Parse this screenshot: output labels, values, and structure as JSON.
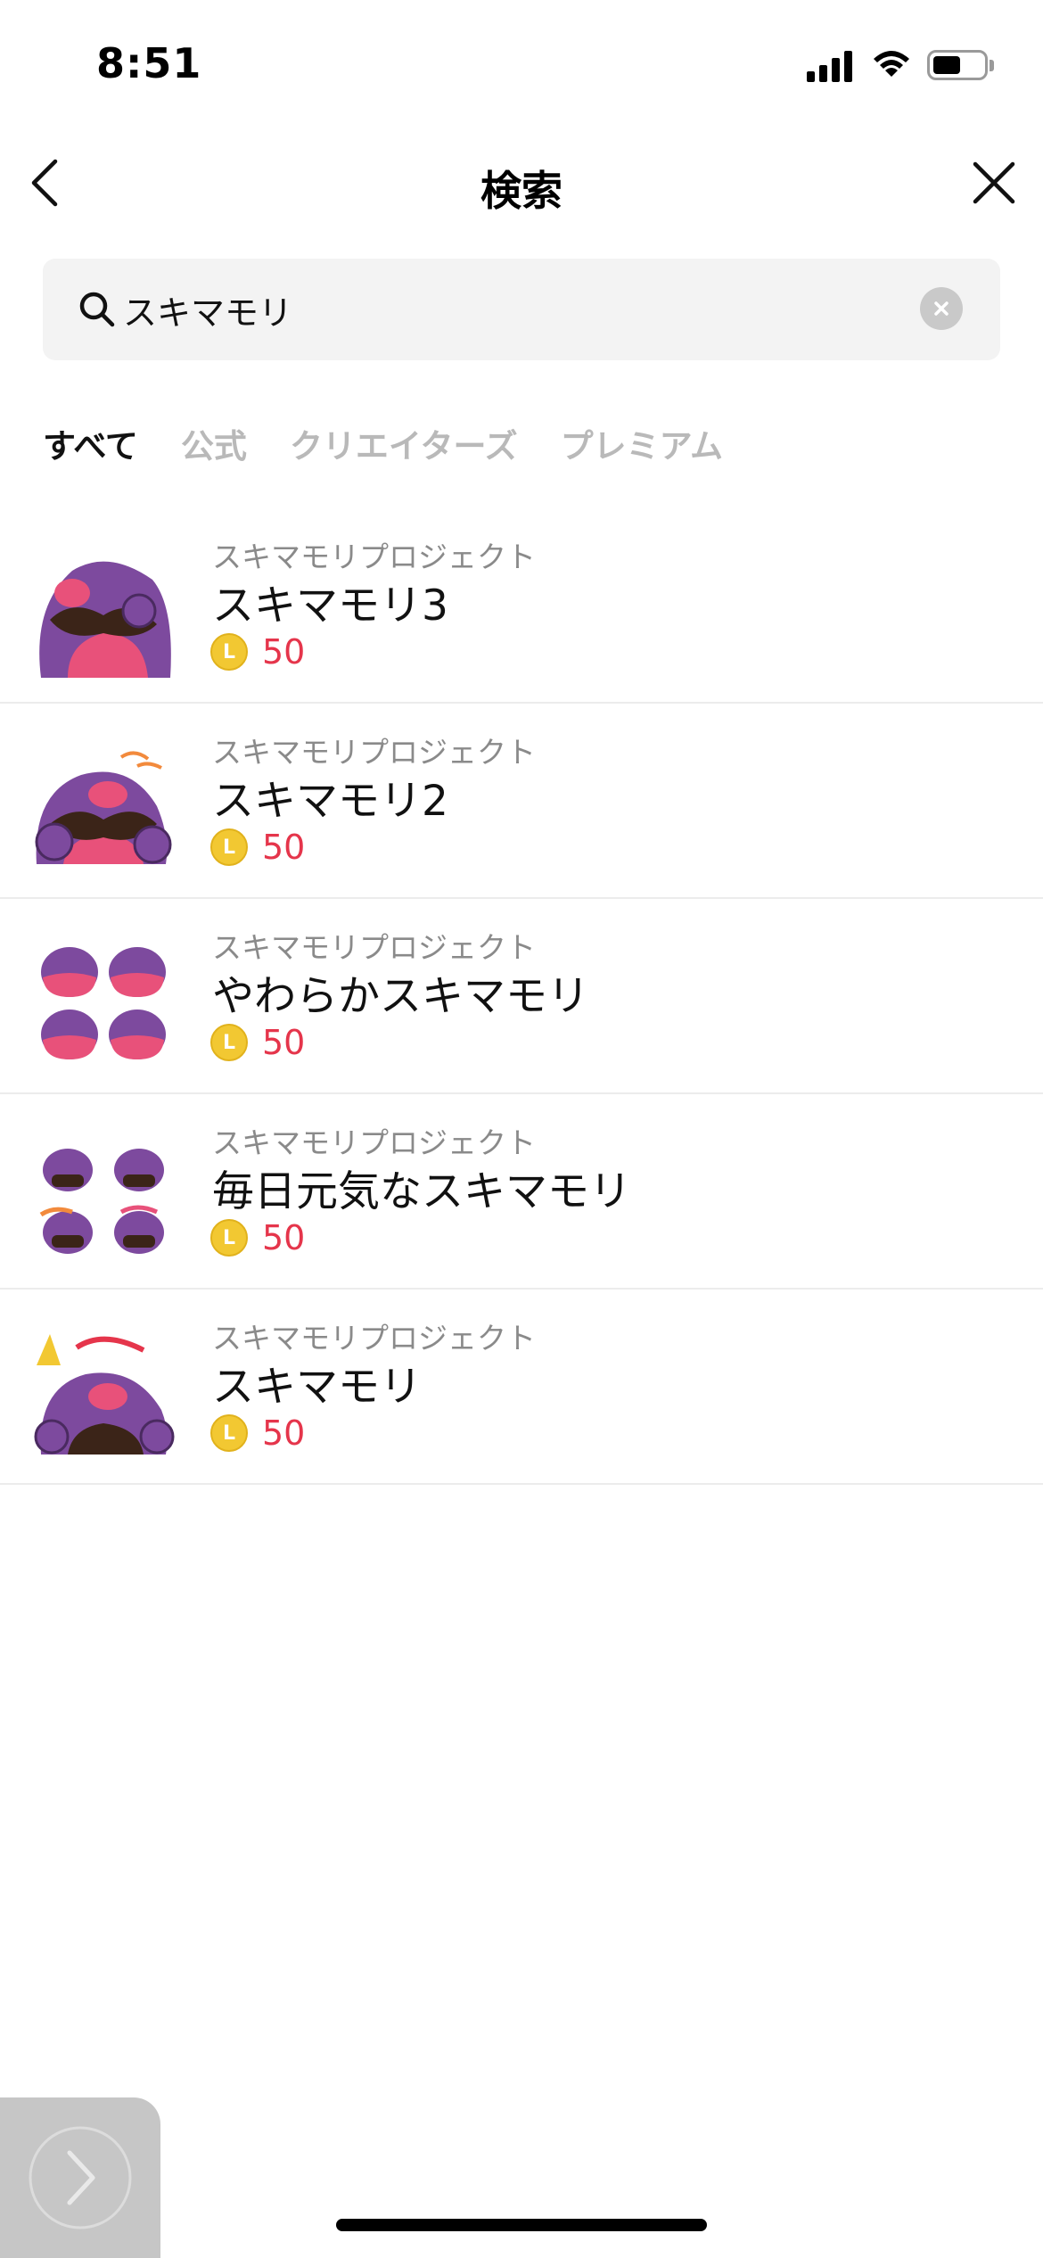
{
  "status_bar": {
    "time": "8:51"
  },
  "header": {
    "title": "検索"
  },
  "search": {
    "value": "スキマモリ",
    "placeholder": ""
  },
  "tabs": [
    {
      "label": "すべて",
      "active": true
    },
    {
      "label": "公式",
      "active": false
    },
    {
      "label": "クリエイターズ",
      "active": false
    },
    {
      "label": "プレミアム",
      "active": false
    }
  ],
  "results": [
    {
      "creator": "スキマモリプロジェクト",
      "title": "スキマモリ3",
      "price": "50",
      "coin_letter": "L"
    },
    {
      "creator": "スキマモリプロジェクト",
      "title": "スキマモリ2",
      "price": "50",
      "coin_letter": "L"
    },
    {
      "creator": "スキマモリプロジェクト",
      "title": "やわらかスキマモリ",
      "price": "50",
      "coin_letter": "L"
    },
    {
      "creator": "スキマモリプロジェクト",
      "title": "毎日元気なスキマモリ",
      "price": "50",
      "coin_letter": "L"
    },
    {
      "creator": "スキマモリプロジェクト",
      "title": "スキマモリ",
      "price": "50",
      "coin_letter": "L"
    }
  ],
  "colors": {
    "accent_price": "#e5354b",
    "coin": "#f2c832",
    "tab_inactive": "#b9b9b9",
    "character_purple": "#7d4a9e",
    "character_pink": "#e8517a"
  },
  "icons": {
    "back": "chevron-left-icon",
    "close": "close-icon",
    "search": "search-icon",
    "clear": "clear-circle-icon",
    "floating": "chevron-right-icon"
  }
}
